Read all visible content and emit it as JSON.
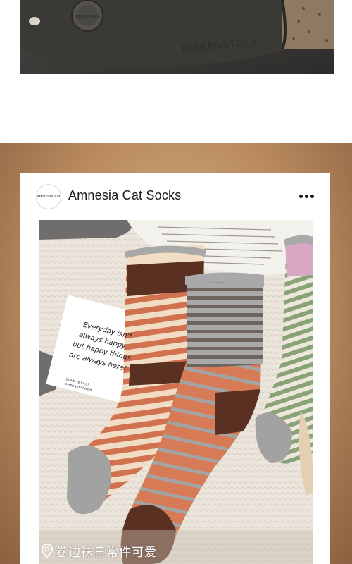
{
  "top_photo": {
    "brand_emboss": "BIRKENSTOCK",
    "rivet_text": "BIRKENSTOCK"
  },
  "post": {
    "avatar_text": "Amnesia cat",
    "account_name": "Amnesia Cat Socks",
    "more_icon": "more-horizontal-icon",
    "photo_card": {
      "line1": "Everyday isn't",
      "line2": "always happy,",
      "line3": "but happy things",
      "line4": "are always here!",
      "small1": "[made to love]",
      "small2": "loving your heard"
    },
    "location_icon": "location-pin-icon",
    "location_text": "卷边袜日常件可爱"
  },
  "colors": {
    "background_warm": "#b98a5e",
    "card": "#ffffff",
    "sock_rust": "#d2714f",
    "sock_brown": "#5a3022",
    "sock_gray": "#a2a2a2",
    "sock_green": "#8aa277"
  }
}
